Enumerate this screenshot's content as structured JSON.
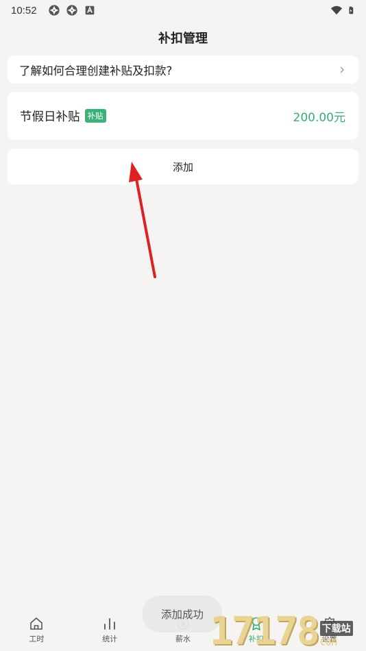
{
  "status_bar": {
    "time": "10:52",
    "left_icons": [
      "aperture-icon",
      "aperture-icon",
      "notification-a-icon"
    ],
    "right_icons": [
      "wifi-icon",
      "battery-charging-icon"
    ]
  },
  "header": {
    "title": "补扣管理"
  },
  "help_card": {
    "text": "了解如何合理创建补贴及扣款?",
    "icon": "chevron-right-icon"
  },
  "items": [
    {
      "name": "节假日补贴",
      "badge": "补贴",
      "amount": "200.00元"
    }
  ],
  "add_button": {
    "label": "添加"
  },
  "toast": {
    "text": "添加成功"
  },
  "bottom_nav": {
    "items": [
      {
        "label": "工时",
        "icon": "home-icon"
      },
      {
        "label": "统计",
        "icon": "bar-chart-icon"
      },
      {
        "label": "薪水",
        "icon": "yuan-coin-icon"
      },
      {
        "label": "补扣",
        "icon": "medal-icon",
        "active": true
      },
      {
        "label": "设置",
        "icon": "gear-icon"
      }
    ]
  },
  "watermark": {
    "digits": "17178",
    "top": "下载站",
    "bottom": "COM"
  },
  "colors": {
    "background": "#f5f4f2",
    "card": "#ffffff",
    "accent_green": "#3aaa74",
    "badge_green": "#3cb27a",
    "annotation_red": "#e02020"
  }
}
